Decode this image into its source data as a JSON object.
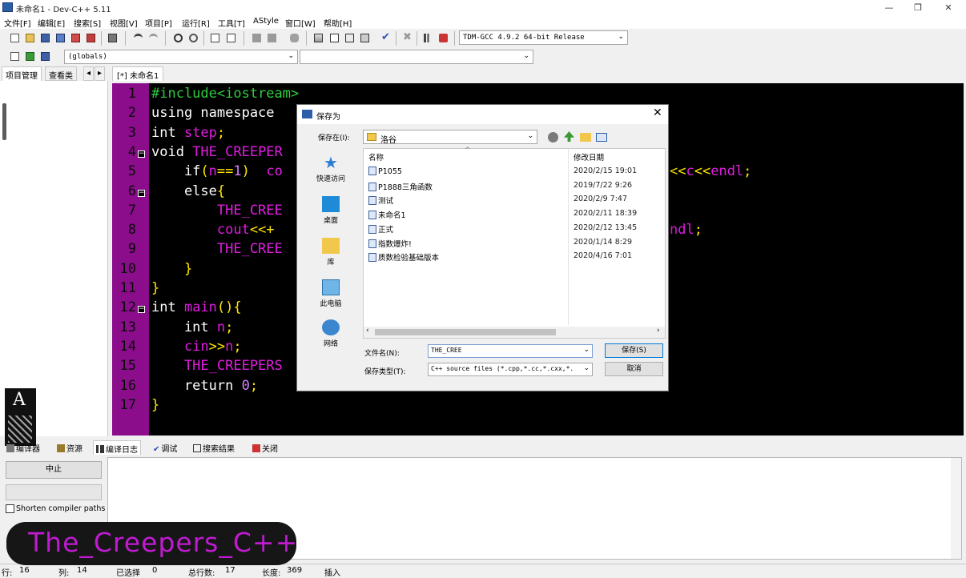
{
  "window": {
    "title": "未命名1 - Dev-C++ 5.11",
    "controls": [
      "—",
      "❐",
      "✕"
    ]
  },
  "menu": [
    "文件[F]",
    "编辑[E]",
    "搜索[S]",
    "视图[V]",
    "项目[P]",
    "运行[R]",
    "工具[T]",
    "AStyle",
    "窗口[W]",
    "帮助[H]"
  ],
  "toolbar": {
    "compiler_select": "TDM-GCC 4.9.2 64-bit Release",
    "scope_select": "(globals)",
    "member_select": ""
  },
  "left_tabs": {
    "project": "项目管理",
    "classes": "查看类",
    "nav_prev": "◂",
    "nav_next": "▸"
  },
  "editor_tab": "[*] 未命名1",
  "code_lines": [
    {
      "n": "1",
      "parts": [
        [
          "k-pre",
          "#include<iostream>"
        ]
      ]
    },
    {
      "n": "2",
      "parts": [
        [
          "k-pl",
          "using namespace"
        ]
      ]
    },
    {
      "n": "3",
      "parts": [
        [
          "k-pl",
          "int "
        ],
        [
          "k-id",
          "step"
        ],
        [
          "k-op",
          ";"
        ]
      ]
    },
    {
      "n": "4",
      "parts": [
        [
          "k-pl",
          "void "
        ],
        [
          "k-id",
          "THE_CREEPER"
        ]
      ]
    },
    {
      "n": "5",
      "parts": [
        [
          "k-pl",
          "    if"
        ],
        [
          "k-op",
          "("
        ],
        [
          "k-id",
          "n"
        ],
        [
          "k-op",
          "=="
        ],
        [
          "k-num",
          "1"
        ],
        [
          "k-op",
          ")  "
        ],
        [
          "k-id",
          "co"
        ]
      ],
      "tail": [
        [
          "k-op",
          "<<"
        ],
        [
          "k-id",
          "c"
        ],
        [
          "k-op",
          "<<"
        ],
        [
          "k-id",
          "endl"
        ],
        [
          "k-op",
          ";"
        ]
      ]
    },
    {
      "n": "6",
      "parts": [
        [
          "k-pl",
          "    else"
        ],
        [
          "k-op",
          "{"
        ]
      ]
    },
    {
      "n": "7",
      "parts": [
        [
          "k-id",
          "        THE_CREE"
        ]
      ]
    },
    {
      "n": "8",
      "parts": [
        [
          "k-id",
          "        cout"
        ],
        [
          "k-op",
          "<<+"
        ]
      ],
      "tail": [
        [
          "k-id",
          "ndl"
        ],
        [
          "k-op",
          ";"
        ]
      ]
    },
    {
      "n": "9",
      "parts": [
        [
          "k-id",
          "        THE_CREE"
        ]
      ]
    },
    {
      "n": "10",
      "parts": [
        [
          "k-op",
          "    }"
        ]
      ]
    },
    {
      "n": "11",
      "parts": [
        [
          "k-op",
          "}"
        ]
      ]
    },
    {
      "n": "12",
      "parts": [
        [
          "k-pl",
          "int "
        ],
        [
          "k-id",
          "main"
        ],
        [
          "k-op",
          "(){"
        ]
      ]
    },
    {
      "n": "13",
      "parts": [
        [
          "k-pl",
          "    int "
        ],
        [
          "k-id",
          "n"
        ],
        [
          "k-op",
          ";"
        ]
      ]
    },
    {
      "n": "14",
      "parts": [
        [
          "k-id",
          "    cin"
        ],
        [
          "k-op",
          ">>"
        ],
        [
          "k-id",
          "n"
        ],
        [
          "k-op",
          ";"
        ]
      ]
    },
    {
      "n": "15",
      "parts": [
        [
          "k-id",
          "    THE_CREEPERS"
        ]
      ]
    },
    {
      "n": "16",
      "parts": [
        [
          "k-pl",
          "    return "
        ],
        [
          "k-num",
          "0"
        ],
        [
          "k-op",
          ";"
        ]
      ]
    },
    {
      "n": "17",
      "parts": [
        [
          "k-op",
          "}"
        ]
      ]
    }
  ],
  "bottom_tabs": [
    "编译器",
    "资源",
    "编译日志",
    "调试",
    "搜索结果",
    "关闭"
  ],
  "bottom_panel": {
    "abort_button": "中止",
    "shorten_label": "Shorten compiler paths"
  },
  "status": {
    "row_label": "行:",
    "row": "16",
    "col_label": "列:",
    "col": "14",
    "sel_label": "已选择",
    "sel": "0",
    "total_label": "总行数:",
    "total": "17",
    "len_label": "长度:",
    "len": "369",
    "mode": "插入"
  },
  "dialog": {
    "title": "保存为",
    "save_in_label": "保存在(I):",
    "save_in_value": "洛谷",
    "places": [
      "快速访问",
      "桌面",
      "库",
      "此电脑",
      "网络"
    ],
    "col_name": "名称",
    "col_date": "修改日期",
    "files": [
      {
        "name": "P1055",
        "date": "2020/2/15 19:01"
      },
      {
        "name": "P1888三角函数",
        "date": "2019/7/22 9:26"
      },
      {
        "name": "测试",
        "date": "2020/2/9 7:47"
      },
      {
        "name": "未命名1",
        "date": "2020/2/11 18:39"
      },
      {
        "name": "正式",
        "date": "2020/2/12 13:45"
      },
      {
        "name": "指数爆炸!",
        "date": "2020/1/14 8:29"
      },
      {
        "name": "质数检验基础版本",
        "date": "2020/4/16 7:01"
      }
    ],
    "filename_label": "文件名(N):",
    "filename_value": "THE_CREE",
    "filetype_label": "保存类型(T):",
    "filetype_value": "C++ source files (*.cpp,*.cc,*.cxx,*.",
    "save_button": "保存(S)",
    "cancel_button": "取消"
  },
  "watermark": "The_Creepers_C++"
}
